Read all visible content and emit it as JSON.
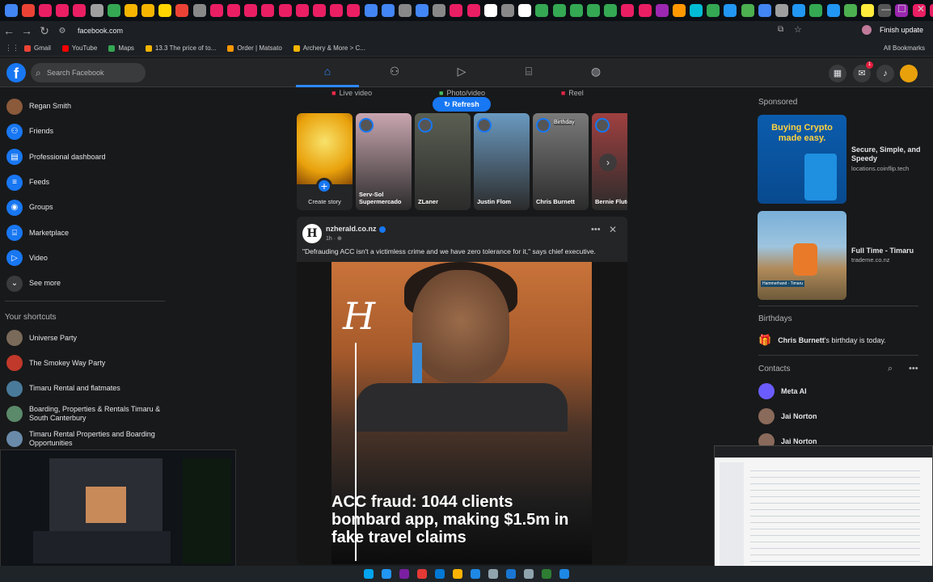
{
  "browser": {
    "url": "facebook.com",
    "finish_update": "Finish update",
    "bookmarks": [
      {
        "label": "Gmail",
        "color": "#ea4335"
      },
      {
        "label": "YouTube",
        "color": "#ff0000"
      },
      {
        "label": "Maps",
        "color": "#34a853"
      },
      {
        "label": "13.3 The price of to...",
        "color": "#f4b400"
      },
      {
        "label": "Order | Matsato",
        "color": "#ff9800"
      },
      {
        "label": "Archery & More > C...",
        "color": "#f4b400"
      }
    ],
    "all_bookmarks": "All Bookmarks",
    "tab_colors": [
      "#4285f4",
      "#ea4335",
      "#e91e63",
      "#e91e63",
      "#e91e63",
      "#9e9e9e",
      "#34a853",
      "#f4b400",
      "#f4b400",
      "#ffd600",
      "#ea4335",
      "#888",
      "#e91e63",
      "#e91e63",
      "#e91e63",
      "#e91e63",
      "#e91e63",
      "#e91e63",
      "#e91e63",
      "#e91e63",
      "#e91e63",
      "#4285f4",
      "#4285f4",
      "#888",
      "#4285f4",
      "#888",
      "#e91e63",
      "#e91e63",
      "#fff",
      "#888",
      "#fff",
      "#34a853",
      "#34a853",
      "#34a853",
      "#34a853",
      "#34a853",
      "#e91e63",
      "#e91e63",
      "#9c27b0",
      "#ff9800",
      "#00bcd4",
      "#34a853",
      "#2196f3",
      "#4caf50",
      "#4285f4",
      "#9e9e9e",
      "#2196f3",
      "#34a853",
      "#2196f3",
      "#4caf50",
      "#ffeb3b",
      "#555",
      "#9c27b0",
      "#e91e63",
      "#e91e63",
      "#4caf50",
      "#4caf50",
      "#ff9800",
      "#4caf50",
      "#34a853",
      "#2196f3",
      "#4285f4",
      "#9c27b0",
      "#888"
    ]
  },
  "fb": {
    "search_placeholder": "Search Facebook",
    "notif_count": "1"
  },
  "left_nav": {
    "items": [
      {
        "label": "Regan Smith",
        "icon": "avatar",
        "color": "#8a5a3b"
      },
      {
        "label": "Friends",
        "icon": "friends-icon",
        "color": "#1877f2"
      },
      {
        "label": "Professional dashboard",
        "icon": "dashboard-icon",
        "color": "#1877f2"
      },
      {
        "label": "Feeds",
        "icon": "feeds-icon",
        "color": "#1877f2"
      },
      {
        "label": "Groups",
        "icon": "groups-icon",
        "color": "#1877f2"
      },
      {
        "label": "Marketplace",
        "icon": "marketplace-icon",
        "color": "#1877f2"
      },
      {
        "label": "Video",
        "icon": "video-icon",
        "color": "#1877f2"
      },
      {
        "label": "See more",
        "icon": "chevron-down-icon",
        "color": "#3a3b3c"
      }
    ],
    "shortcuts_title": "Your shortcuts",
    "shortcuts": [
      {
        "label": "Universe Party",
        "color": "#7a6a5a"
      },
      {
        "label": "The Smokey Way Party",
        "color": "#c0392b"
      },
      {
        "label": "Timaru Rental and flatmates",
        "color": "#4a7a9a"
      },
      {
        "label": "Boarding, Properties & Rentals Timaru & South Canterbury",
        "color": "#5a8a6a"
      },
      {
        "label": "Timaru Rental Properties and Boarding Opportunities",
        "color": "#6a8aaa"
      }
    ]
  },
  "composer": {
    "live": "Live video",
    "photo": "Photo/video",
    "reel": "Reel",
    "refresh": "Refresh"
  },
  "stories": {
    "create": "Create story",
    "items": [
      {
        "name": "Serv-Sol Supermercado",
        "bg": "#c9a6b0"
      },
      {
        "name": "ZLaner",
        "bg": "#5a5f52"
      },
      {
        "name": "Justin Flom",
        "bg": "#6a9ac0"
      },
      {
        "name": "Chris Burnett",
        "bg": "#7a7a7a",
        "tag": "Birthday"
      },
      {
        "name": "Bernie Flute",
        "bg": "#a04040"
      }
    ]
  },
  "post": {
    "author": "nzherald.co.nz",
    "time": "1h · ⊕",
    "text": "\"Defrauding ACC isn't a victimless crime and we have zero tolerance for it,\" says chief executive.",
    "headline": "ACC fraud: 1044 clients bombard app, making $1.5m in fake travel claims",
    "logo_letter": "H"
  },
  "right": {
    "sponsored": "Sponsored",
    "ads": [
      {
        "title": "Secure, Simple, and Speedy",
        "url": "locations.coinflip.tech",
        "img_title": "Buying Crypto made easy."
      },
      {
        "title": "Full Time - Timaru",
        "url": "trademe.co.nz",
        "img_title": "Hammerhand - Timaru"
      }
    ],
    "birthdays_title": "Birthdays",
    "birthday_name": "Chris Burnett",
    "birthday_text": "'s birthday is today.",
    "contacts_title": "Contacts",
    "contacts": [
      {
        "name": "Meta AI",
        "color": "#6b5cff"
      },
      {
        "name": "Jai Norton",
        "color": "#8a6a5a"
      },
      {
        "name": "Jai Norton",
        "color": "#8a6a5a"
      }
    ]
  },
  "taskbar": {
    "icon_colors": [
      "#00a4ef",
      "#2196f3",
      "#7b1fa2",
      "#e53935",
      "#0078d4",
      "#ffb300",
      "#1e88e5",
      "#90a4ae",
      "#1976d2",
      "#90a4ae",
      "#2e7d32",
      "#1e88e5"
    ]
  }
}
